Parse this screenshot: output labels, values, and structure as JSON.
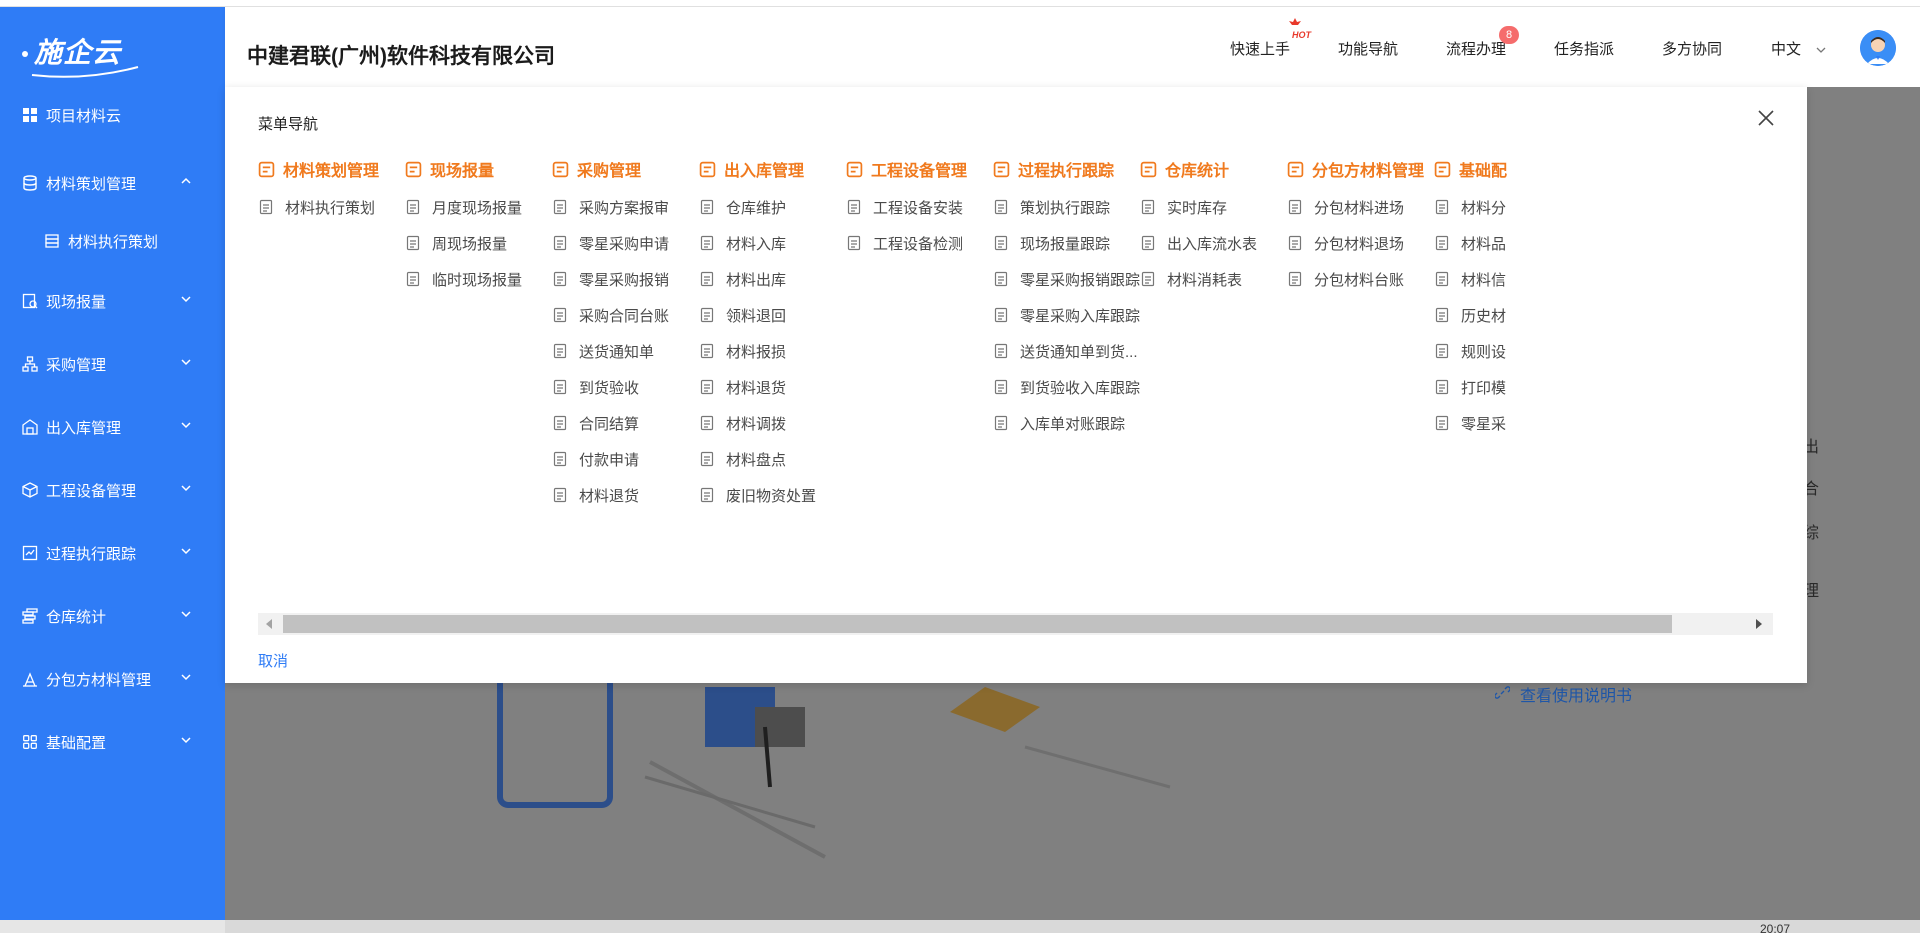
{
  "app": {
    "logo_text": "施企云",
    "company_name": "中建君联(广州)软件科技有限公司"
  },
  "header": {
    "nav": [
      "快速上手",
      "功能导航",
      "流程办理",
      "任务指派",
      "多方协同"
    ],
    "hot_label": "HOT",
    "workflow_badge": "8",
    "language": "中文"
  },
  "sidebar": {
    "items": [
      {
        "label": "项目材料云",
        "icon": "grid-icon"
      },
      {
        "label": "材料策划管理",
        "icon": "database-icon",
        "expanded": true
      },
      {
        "label": "材料执行策划",
        "icon": "stack-icon",
        "sub": true
      },
      {
        "label": "现场报量",
        "icon": "report-icon"
      },
      {
        "label": "采购管理",
        "icon": "org-icon"
      },
      {
        "label": "出入库管理",
        "icon": "warehouse-icon"
      },
      {
        "label": "工程设备管理",
        "icon": "cube-icon"
      },
      {
        "label": "过程执行跟踪",
        "icon": "track-icon"
      },
      {
        "label": "仓库统计",
        "icon": "coins-icon"
      },
      {
        "label": "分包方材料管理",
        "icon": "chart-icon"
      },
      {
        "label": "基础配置",
        "icon": "apps-icon"
      }
    ]
  },
  "modal": {
    "title": "菜单导航",
    "cancel_label": "取消",
    "columns": [
      {
        "title": "材料策划管理",
        "items": [
          "材料执行策划"
        ]
      },
      {
        "title": "现场报量",
        "items": [
          "月度现场报量",
          "周现场报量",
          "临时现场报量"
        ]
      },
      {
        "title": "采购管理",
        "items": [
          "采购方案报审",
          "零星采购申请",
          "零星采购报销",
          "采购合同台账",
          "送货通知单",
          "到货验收",
          "合同结算",
          "付款申请",
          "材料退货"
        ]
      },
      {
        "title": "出入库管理",
        "items": [
          "仓库维护",
          "材料入库",
          "材料出库",
          "领料退回",
          "材料报损",
          "材料退货",
          "材料调拨",
          "材料盘点",
          "废旧物资处置"
        ]
      },
      {
        "title": "工程设备管理",
        "items": [
          "工程设备安装",
          "工程设备检测"
        ]
      },
      {
        "title": "过程执行跟踪",
        "items": [
          "策划执行跟踪",
          "现场报量跟踪",
          "零星采购报销跟踪",
          "零星采购入库跟踪",
          "送货通知单到货...",
          "到货验收入库跟踪",
          "入库单对账跟踪"
        ]
      },
      {
        "title": "仓库统计",
        "items": [
          "实时库存",
          "出入库流水表",
          "材料消耗表"
        ]
      },
      {
        "title": "分包方材料管理",
        "items": [
          "分包材料进场",
          "分包材料退场",
          "分包材料台账"
        ]
      },
      {
        "title": "基础配",
        "items": [
          "材料分",
          "材料品",
          "材料信",
          "历史材",
          "规则设",
          "打印模",
          "零星采"
        ]
      }
    ]
  },
  "background": {
    "help_link": "查看使用说明书",
    "peek_chars": [
      "出",
      "合",
      "综",
      "理"
    ],
    "time_text": "20:07"
  }
}
